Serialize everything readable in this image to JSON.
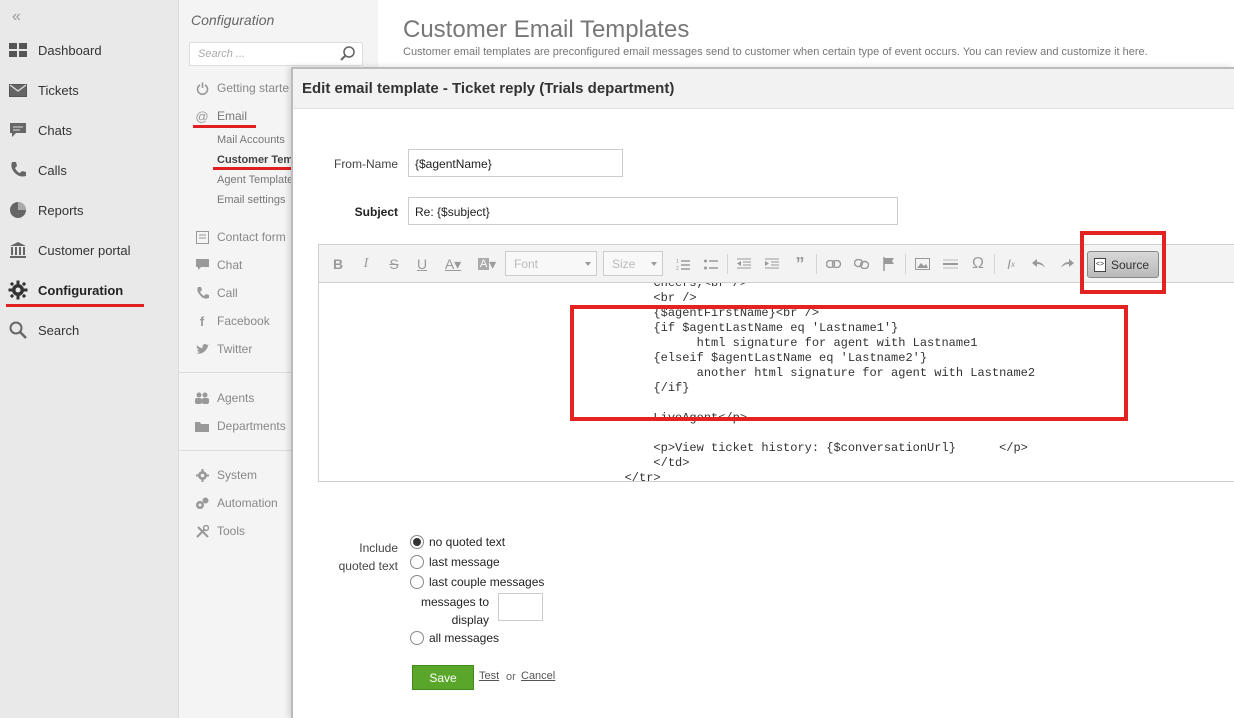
{
  "main_nav": {
    "items": [
      {
        "label": "Dashboard",
        "icon": "dashboard-icon"
      },
      {
        "label": "Tickets",
        "icon": "envelope-icon"
      },
      {
        "label": "Chats",
        "icon": "chat-icon"
      },
      {
        "label": "Calls",
        "icon": "phone-icon"
      },
      {
        "label": "Reports",
        "icon": "pie-chart-icon"
      },
      {
        "label": "Customer portal",
        "icon": "bank-icon"
      },
      {
        "label": "Configuration",
        "icon": "gear-icon",
        "active": true
      },
      {
        "label": "Search",
        "icon": "search-icon"
      }
    ]
  },
  "sub_nav": {
    "title": "Configuration",
    "search_placeholder": "Search ...",
    "items": {
      "getting_started": "Getting starte",
      "email": "Email",
      "email_children": [
        "Mail Accounts",
        "Customer Temp",
        "Agent Template",
        "Email settings"
      ],
      "contact_form": "Contact form",
      "chat": "Chat",
      "call": "Call",
      "facebook": "Facebook",
      "twitter": "Twitter",
      "agents": "Agents",
      "departments": "Departments",
      "system": "System",
      "automation": "Automation",
      "tools": "Tools"
    }
  },
  "page": {
    "title": "Customer Email Templates",
    "description": "Customer email templates are preconfigured email messages send to customer when certain type of event occurs. You can review and customize it here."
  },
  "dialog": {
    "title": "Edit email template - Ticket reply (Trials department)",
    "from_name_label": "From-Name",
    "from_name_value": "{$agentName}",
    "subject_label": "Subject",
    "subject_value": "Re: {$subject}",
    "toolbar": {
      "font_label": "Font",
      "size_label": "Size",
      "source_label": "Source"
    },
    "code_lines": [
      "            Cheers,<br />",
      "            <br />",
      "            {$agentFirstName}<br />",
      "            {if $agentLastName eq 'Lastname1'}",
      "                  html signature for agent with Lastname1",
      "            {elseif $agentLastName eq 'Lastname2'}",
      "                  another html signature for agent with Lastname2",
      "            {/if}",
      "",
      "            LiveAgent</p>",
      "",
      "            <p>View ticket history: {$conversationUrl}      </p>",
      "            </td>",
      "        </tr>"
    ],
    "include_label_line1": "Include",
    "include_label_line2": "quoted text",
    "radio_options": [
      {
        "label": "no quoted text",
        "checked": true
      },
      {
        "label": "last message",
        "checked": false
      },
      {
        "label": "last couple messages",
        "checked": false
      },
      {
        "label": "all messages",
        "checked": false
      }
    ],
    "messages_to_display_line1": "messages to",
    "messages_to_display_line2": "display",
    "save_label": "Save",
    "test_label": "Test",
    "or_label": "or",
    "cancel_label": "Cancel"
  },
  "colors": {
    "annotation_red": "#e32222",
    "save_green": "#5aa62a",
    "sidebar_bg": "#e9e9e9"
  }
}
